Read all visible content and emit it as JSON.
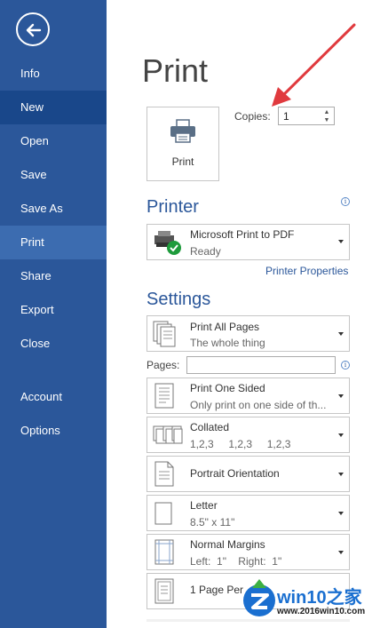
{
  "sidebar": {
    "back_icon": "back-arrow-icon",
    "items": [
      {
        "label": "Info"
      },
      {
        "label": "New"
      },
      {
        "label": "Open"
      },
      {
        "label": "Save"
      },
      {
        "label": "Save As"
      },
      {
        "label": "Print"
      },
      {
        "label": "Share"
      },
      {
        "label": "Export"
      },
      {
        "label": "Close"
      },
      {
        "label": "Account"
      },
      {
        "label": "Options"
      }
    ],
    "active": "Print"
  },
  "page": {
    "title": "Print"
  },
  "print_button": {
    "label": "Print",
    "icon": "printer-icon"
  },
  "copies": {
    "label": "Copies:",
    "value": "1"
  },
  "printer": {
    "heading": "Printer",
    "name": "Microsoft Print to PDF",
    "status": "Ready",
    "properties_link": "Printer Properties"
  },
  "settings": {
    "heading": "Settings",
    "pages_label": "Pages:",
    "pages_value": "",
    "options": [
      {
        "line1": "Print All Pages",
        "line2": "The whole thing",
        "icon": "pages-stack-icon"
      },
      {
        "line1": "Print One Sided",
        "line2": "Only print on one side of th...",
        "icon": "one-sided-page-icon"
      },
      {
        "line1": "Collated",
        "line2": "1,2,3     1,2,3     1,2,3",
        "icon": "collated-icon"
      },
      {
        "line1": "Portrait Orientation",
        "line2": "",
        "icon": "portrait-page-icon"
      },
      {
        "line1": "Letter",
        "line2": "8.5\" x 11\"",
        "icon": "letter-page-icon"
      },
      {
        "line1": "Normal Margins",
        "line2": "Left:  1\"    Right:  1\"",
        "icon": "margins-icon"
      },
      {
        "line1": "1 Page Per",
        "line2": "",
        "icon": "pages-per-sheet-icon"
      }
    ]
  },
  "watermark": {
    "title": "win10之家",
    "url": "www.2016win10.com"
  },
  "colors": {
    "sidebar": "#2b579a",
    "accent": "#2b579a",
    "annotation_arrow": "#e03a3e"
  }
}
